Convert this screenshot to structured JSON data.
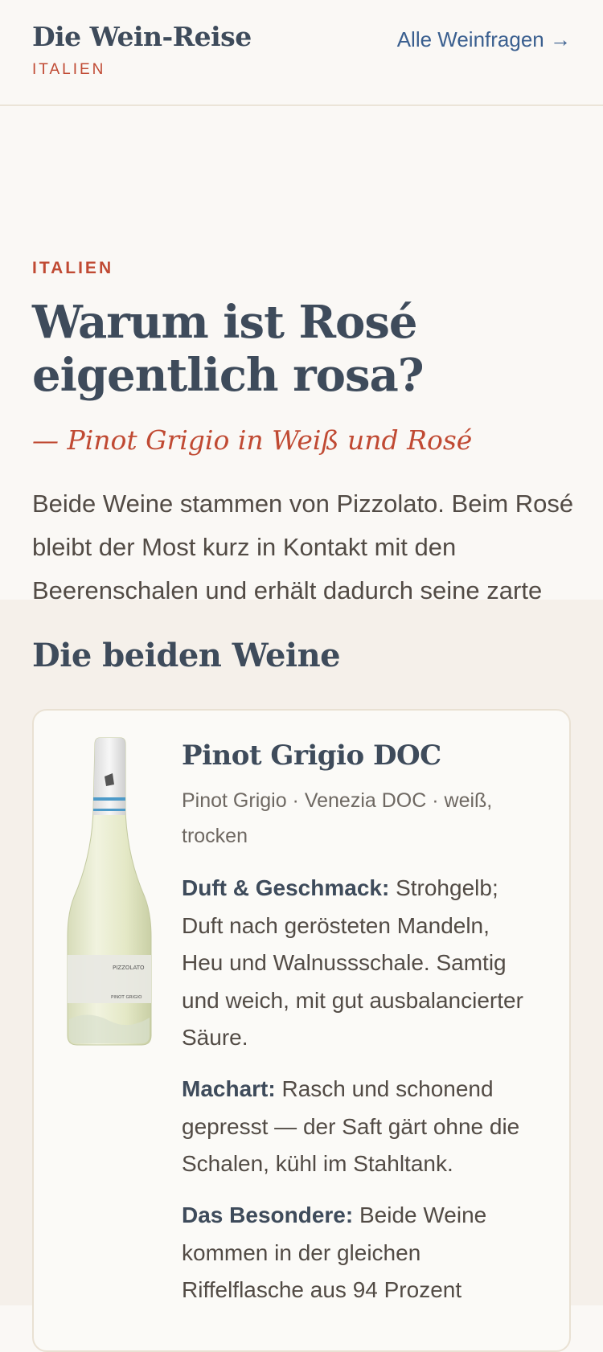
{
  "header": {
    "title": "Die Wein-Reise",
    "subtitle": "ITALIEN",
    "link": "Alle Weinfragen →"
  },
  "hero": {
    "kicker": "ITALIEN",
    "title": "Warum ist Rosé eigentlich rosa?",
    "subtitle": "— Pinot Grigio in Weiß und Rosé",
    "lede": "Beide Weine stammen von Pizzolato. Beim Rosé bleibt der Most kurz in Kontakt mit den Beerenschalen und erhält dadurch seine zarte Farbe."
  },
  "section": {
    "title": "Die beiden Weine"
  },
  "wines": [
    {
      "name": "Pinot Grigio DOC",
      "meta": "Pinot Grigio · Venezia DOC · weiß, trocken",
      "bottle_label_brand": "PIZZOLATO",
      "bottle_label_variety": "PINOT GRIGIO",
      "sections": [
        {
          "label": "Duft & Geschmack:",
          "text": "Strohgelb; Duft nach gerösteten Mandeln, Heu und Walnussschale. Samtig und weich, mit gut ausbalancierter Säure."
        },
        {
          "label": "Machart:",
          "text": "Rasch und schonend gepresst — der Saft gärt ohne die Schalen, kühl im Stahltank."
        },
        {
          "label": "Das Besondere:",
          "text": "Beide Weine kommen in der gleichen Riffelflasche aus 94 Prozent"
        }
      ]
    }
  ],
  "colors": {
    "accent_red": "#c04a33",
    "heading_slate": "#3e4b5b",
    "link_blue": "#3a5f8f",
    "page_bg": "#faf8f5",
    "section_bg": "#f5f0ea"
  }
}
